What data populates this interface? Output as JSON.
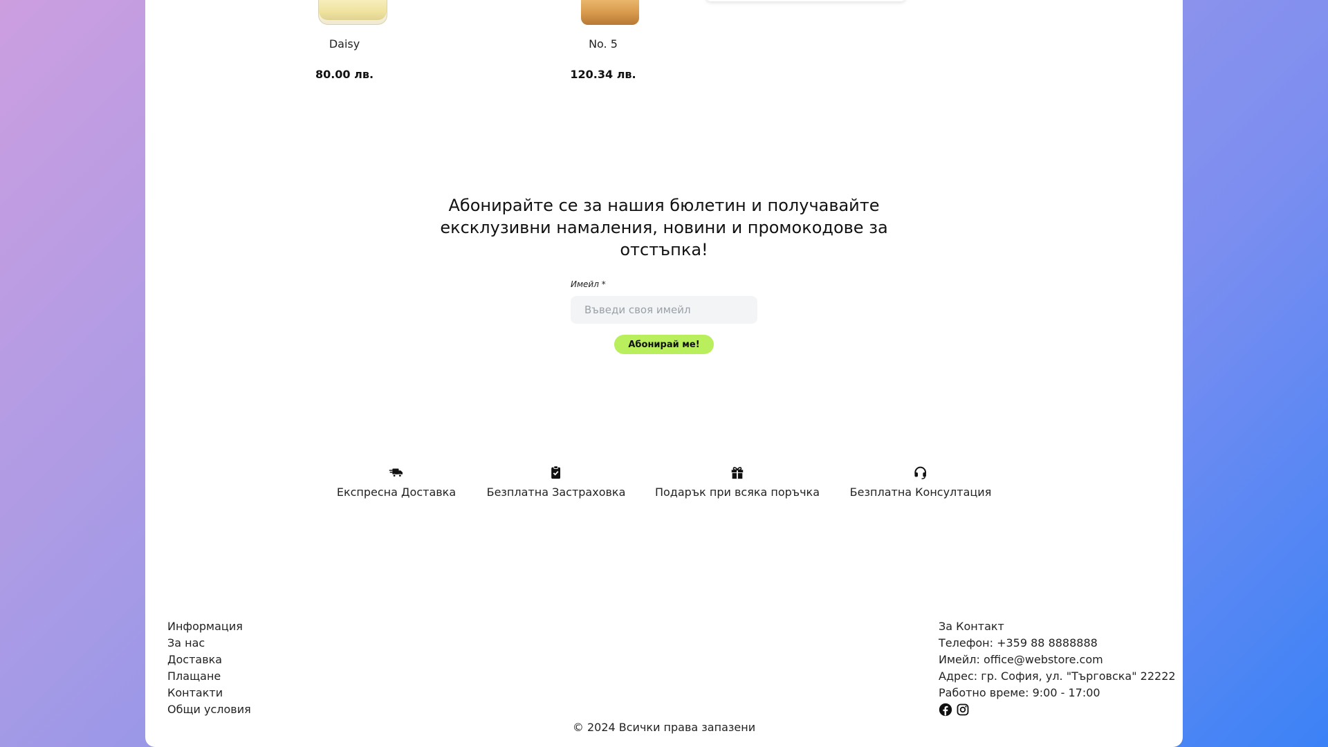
{
  "products": [
    {
      "name": "Daisy",
      "price": "80.00 лв."
    },
    {
      "name": "No. 5",
      "price": "120.34 лв."
    }
  ],
  "newsletter": {
    "title": "Абонирайте се за нашия бюлетин и получавайте ексклузивни намаления, новини и промокодове за отстъпка!",
    "email_label": "Имейл *",
    "email_placeholder": "Въведи своя имейл",
    "email_value": "",
    "submit_label": "Абонирай ме!",
    "submit_color": "#b9ef5c"
  },
  "features": [
    {
      "icon": "truck-fast-icon",
      "label": "Експресна Доставка"
    },
    {
      "icon": "clipboard-check-icon",
      "label": "Безплатна Застраховка"
    },
    {
      "icon": "gift-icon",
      "label": "Подарък при всяка поръчка"
    },
    {
      "icon": "headset-icon",
      "label": "Безплатна Консултация"
    }
  ],
  "footer": {
    "info": {
      "heading": "Информация",
      "links": [
        "За нас",
        "Доставка",
        "Плащане",
        "Контакти",
        "Общи условия"
      ]
    },
    "contact": {
      "heading": "За Контакт",
      "phone": "Телефон: +359 88 8888888",
      "email": "Имейл: office@webstore.com",
      "address": "Адрес: гр. София, ул. \"Търговска\" 22222",
      "hours": "Работно време: 9:00 - 17:00",
      "social": [
        "facebook-icon",
        "instagram-icon"
      ]
    },
    "copyright": "© 2024 Всички права запазени"
  },
  "colors": {
    "gradient_start": "#cc9ee0",
    "gradient_end": "#3b82f6",
    "panel": "#ffffff",
    "accent": "#b9ef5c"
  }
}
